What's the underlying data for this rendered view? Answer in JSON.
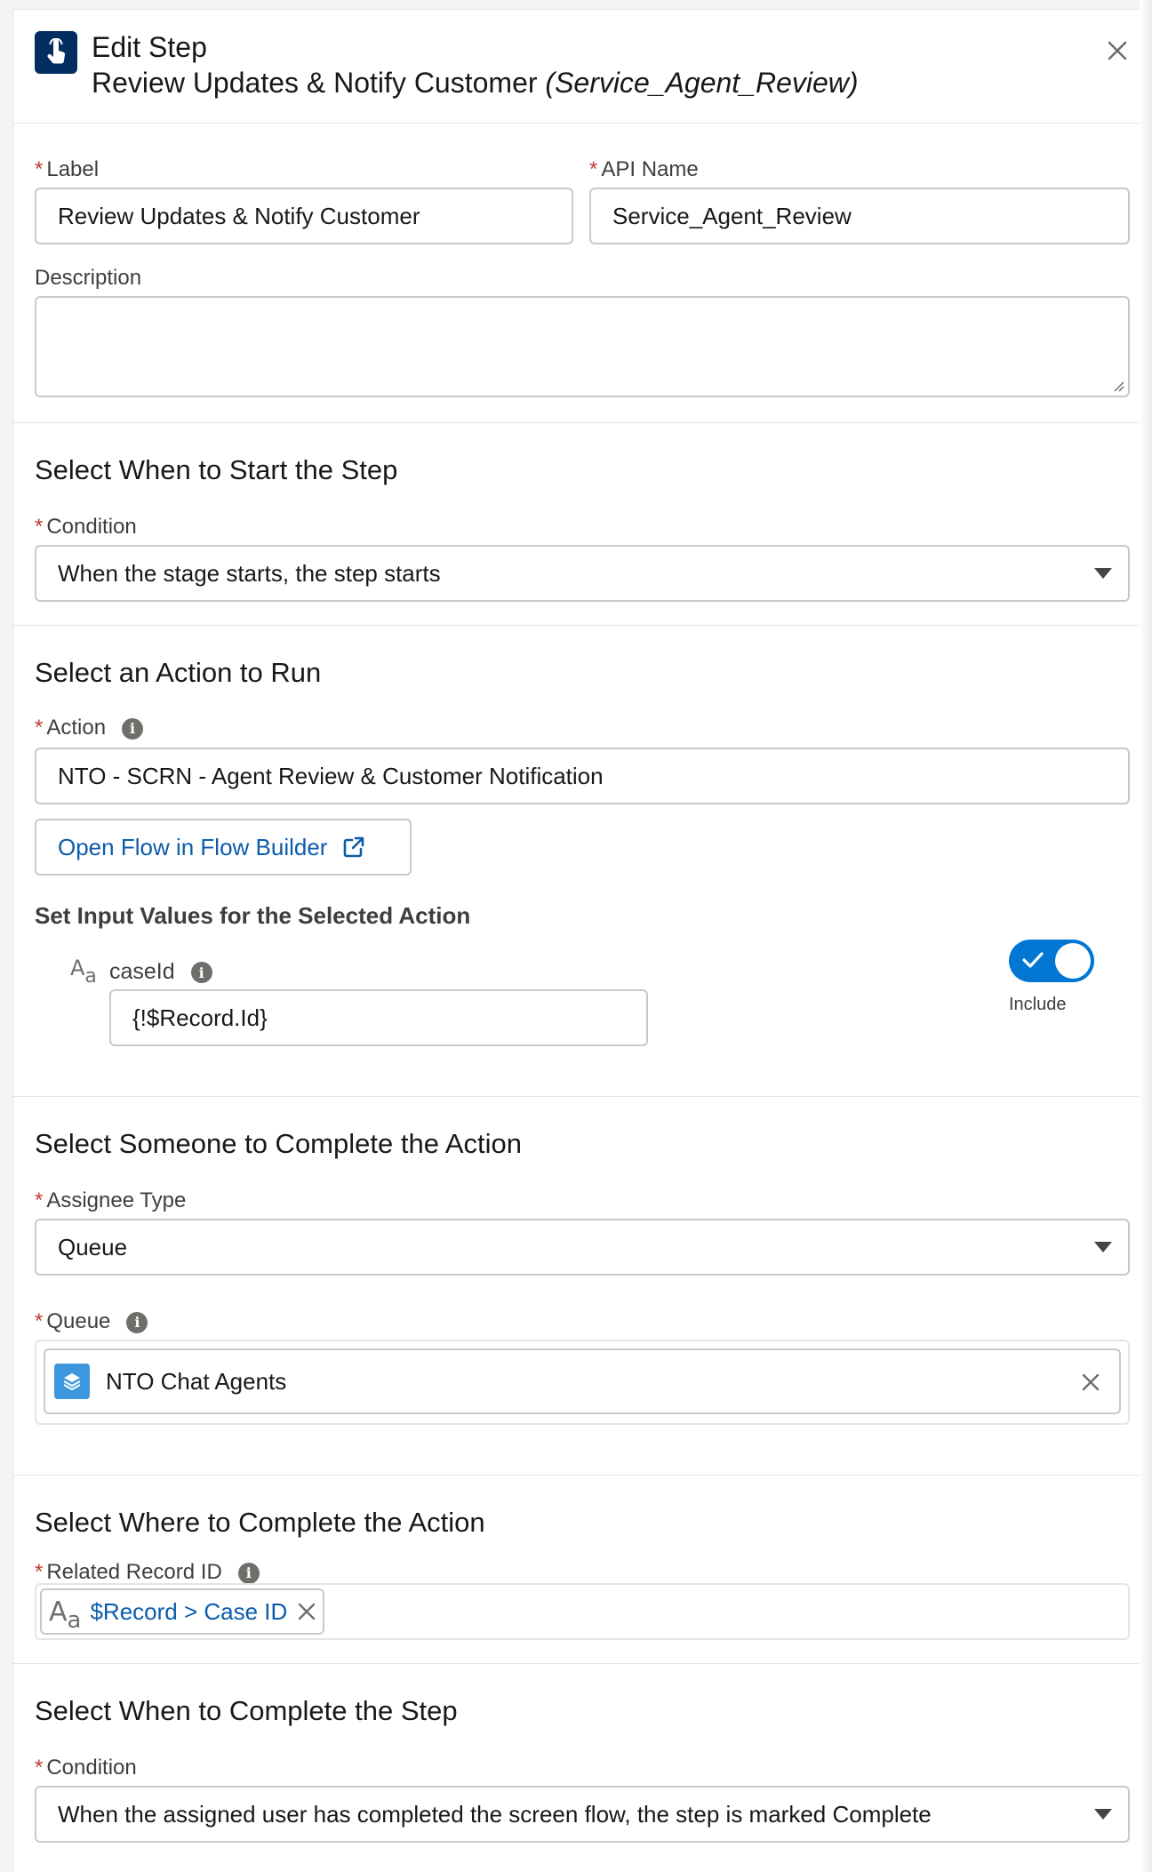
{
  "header": {
    "title": "Edit Step",
    "subtitle": "Review Updates & Notify Customer",
    "subtitle_api": "(Service_Agent_Review)",
    "icon": "touch-hand-icon",
    "close_icon": "close-icon"
  },
  "details": {
    "label_field": {
      "label": "Label",
      "value": "Review Updates & Notify Customer"
    },
    "api_name_field": {
      "label": "API Name",
      "value": "Service_Agent_Review"
    },
    "description_field": {
      "label": "Description",
      "value": ""
    }
  },
  "start_section": {
    "title": "Select When to Start the Step",
    "condition_label": "Condition",
    "condition_value": "When the stage starts, the step starts"
  },
  "action_section": {
    "title": "Select an Action to Run",
    "action_label": "Action",
    "action_value": "NTO - SCRN - Agent Review & Customer Notification",
    "open_flow_button": "Open Flow in Flow Builder",
    "inputs_heading": "Set Input Values for the Selected Action",
    "input": {
      "type_icon_text": "Aa",
      "name": "caseId",
      "value": "{!$Record.Id}",
      "include_label": "Include",
      "include_on": true
    }
  },
  "assignee_section": {
    "title": "Select Someone to Complete the Action",
    "assignee_type_label": "Assignee Type",
    "assignee_type_value": "Queue",
    "queue_label": "Queue",
    "queue_value": "NTO Chat Agents"
  },
  "where_section": {
    "title": "Select Where to Complete the Action",
    "related_record_label": "Related Record ID",
    "related_record_value": "$Record > Case ID",
    "type_icon_text": "Aa"
  },
  "complete_section": {
    "title": "Select When to Complete the Step",
    "condition_label": "Condition",
    "condition_value": "When the assigned user has completed the screen flow, the step is marked Complete"
  },
  "colors": {
    "brand": "#0176d3",
    "link": "#0b5cab",
    "required": "#c23934",
    "header_icon_bg": "#032d60"
  }
}
